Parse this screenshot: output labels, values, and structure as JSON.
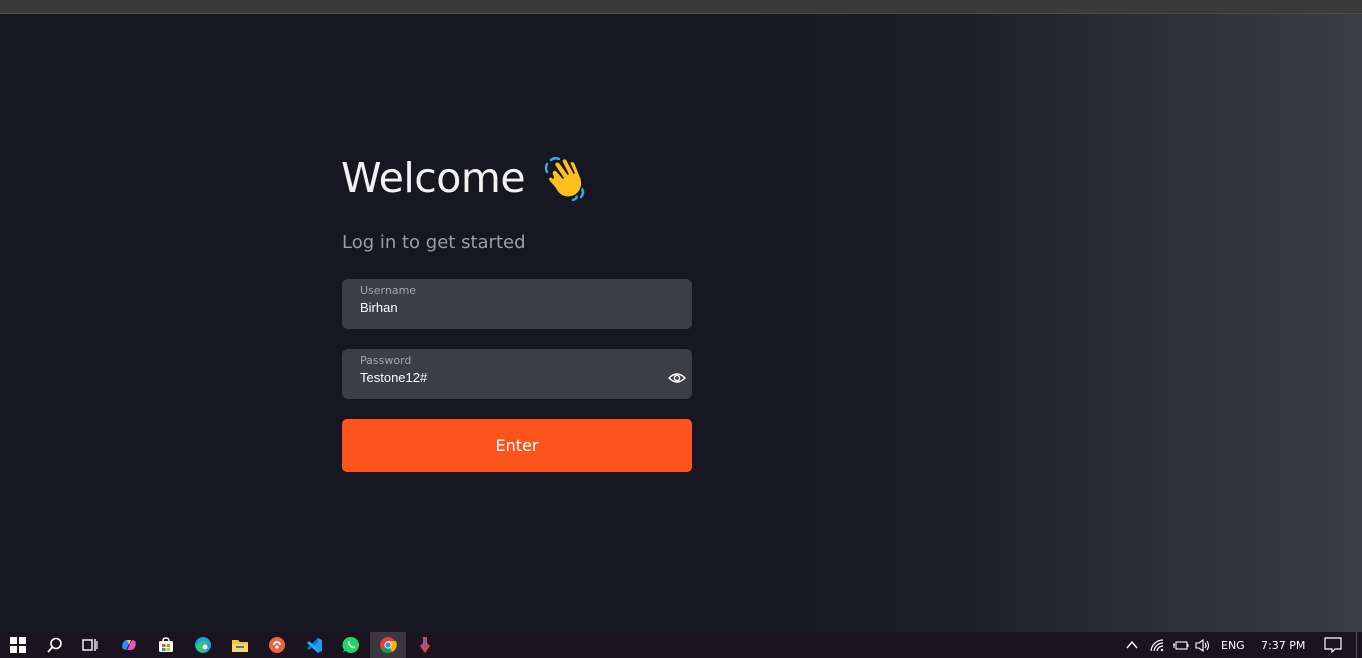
{
  "login": {
    "title": "Welcome",
    "subtitle": "Log in to get started",
    "username": {
      "label": "Username",
      "value": "Birhan"
    },
    "password": {
      "label": "Password",
      "value": "Testone12#"
    },
    "submit_label": "Enter"
  },
  "colors": {
    "accent": "#fd541d",
    "input_bg": "#3c3d47",
    "page_bg": "#161720"
  },
  "taskbar": {
    "apps": [
      "start-icon",
      "search-icon",
      "task-view-icon",
      "copilot-icon",
      "store-icon",
      "edge-icon",
      "file-explorer-icon",
      "app-orange-icon",
      "vscode-icon",
      "whatsapp-icon",
      "chrome-icon",
      "app-tool-icon"
    ],
    "tray": {
      "language": "ENG",
      "time": "7:37 PM"
    }
  }
}
